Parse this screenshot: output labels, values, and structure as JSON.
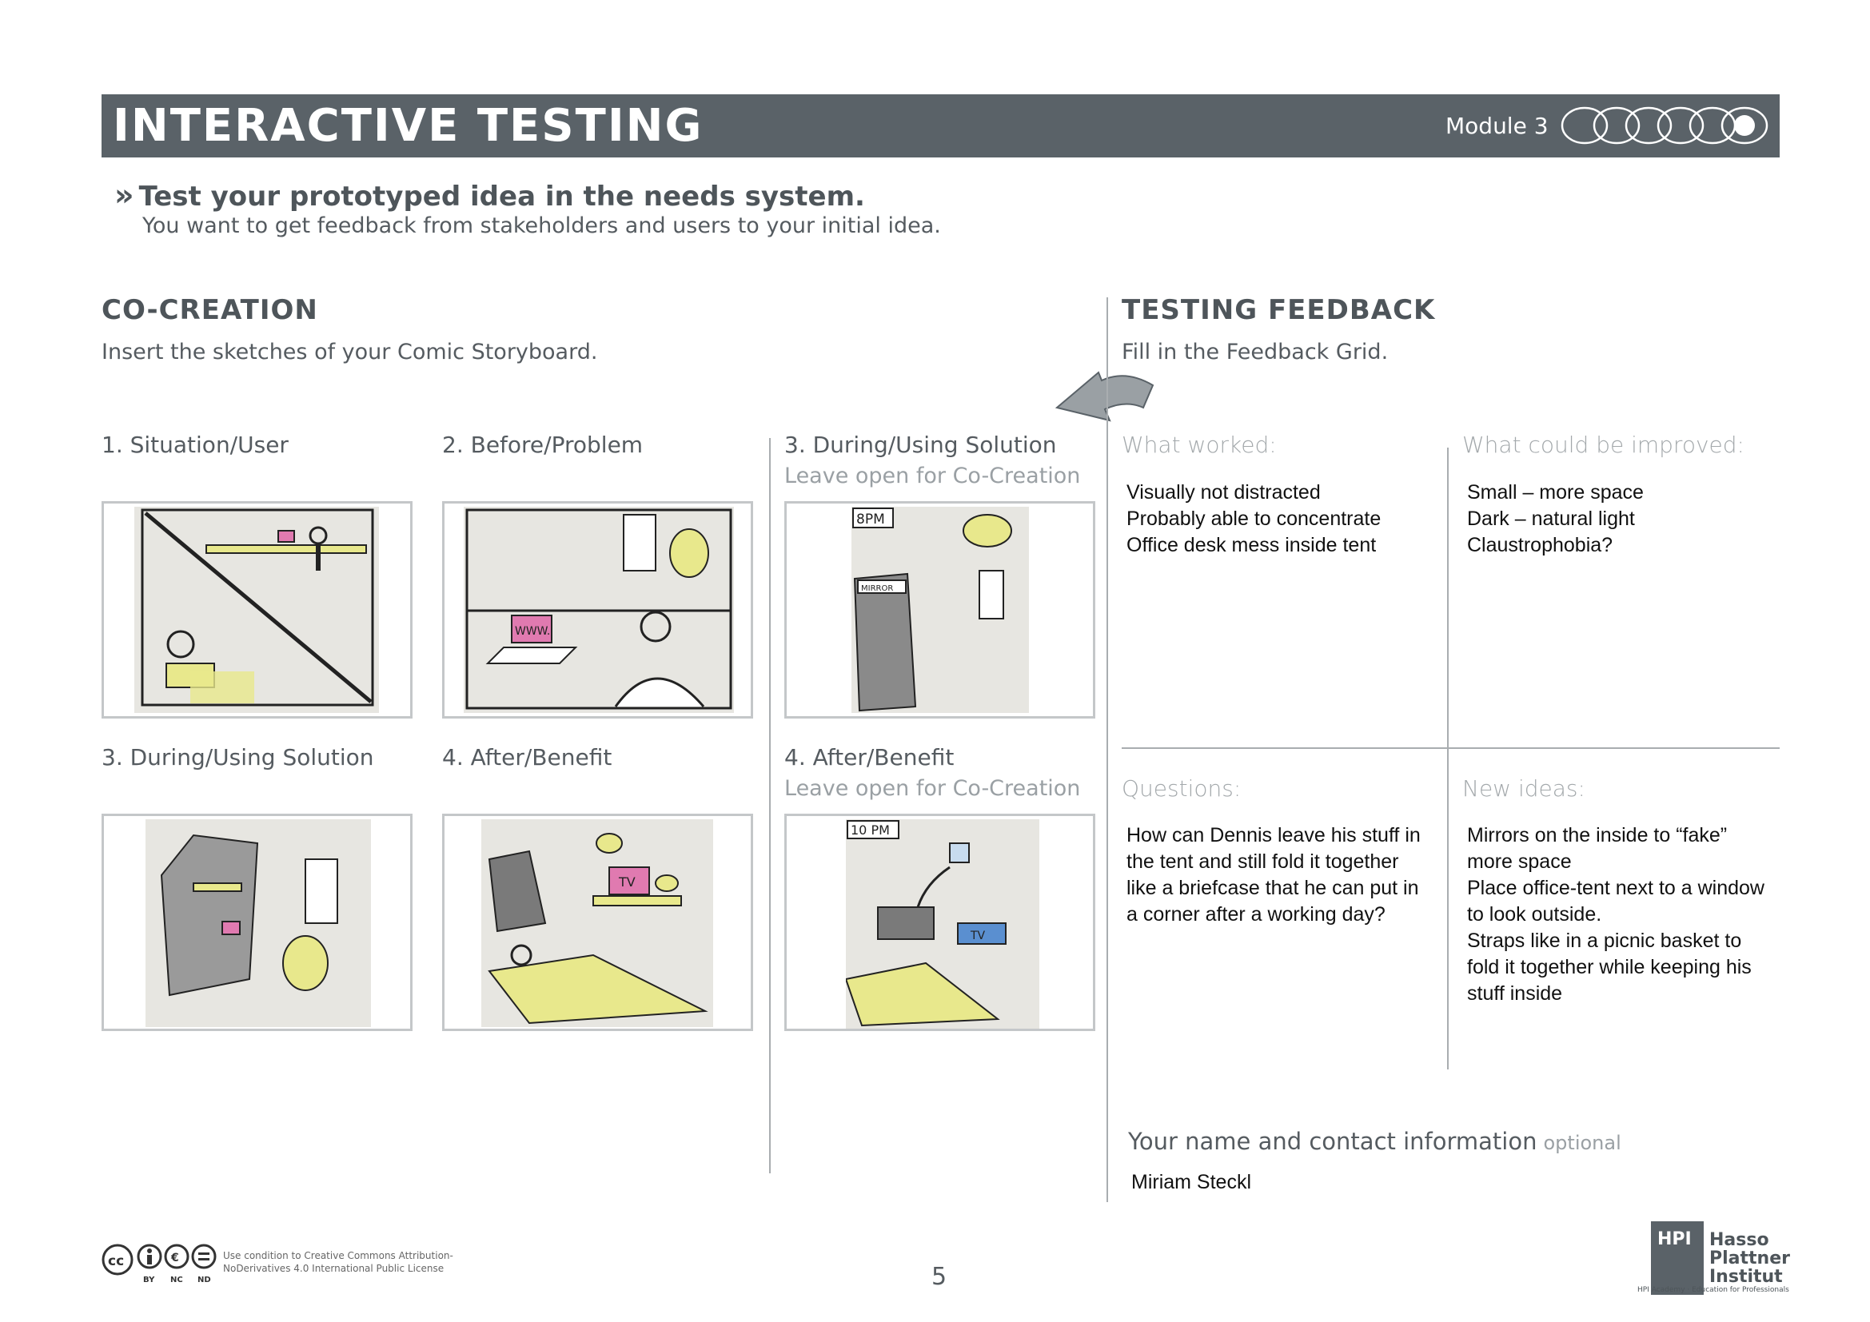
{
  "header": {
    "title": "INTERACTIVE TESTING",
    "module": "Module 3",
    "progress_total": 6,
    "progress_current": 6
  },
  "intro": {
    "title": "Test your prototyped idea in the needs system.",
    "subtitle": "You want to get feedback from stakeholders and users to your initial idea."
  },
  "cocreation": {
    "title": "CO-CREATION",
    "description": "Insert the sketches of your Comic Storyboard.",
    "panels": [
      {
        "label": "1. Situation/User",
        "note": ""
      },
      {
        "label": "2. Before/Problem",
        "note": ""
      },
      {
        "label": "3. During/Using Solution",
        "note": "Leave open for Co-Creation",
        "sketch_text": [
          "8PM",
          "MIRROR"
        ]
      },
      {
        "label": "3. During/Using Solution",
        "note": ""
      },
      {
        "label": "4. After/Benefit",
        "note": "",
        "sketch_text": [
          "TV"
        ]
      },
      {
        "label": "4. After/Benefit",
        "note": "Leave open for Co-Creation",
        "sketch_text": [
          "10 PM",
          "TV"
        ]
      }
    ],
    "sketch_www": "WWW."
  },
  "feedback": {
    "title": "TESTING FEEDBACK",
    "description": "Fill in the Feedback Grid.",
    "worked": {
      "label": "What worked:",
      "lines": [
        "Visually not distracted",
        "Probably able to concentrate",
        "Office desk mess inside tent"
      ]
    },
    "improved": {
      "label": "What could be improved:",
      "lines": [
        "Small – more space",
        "Dark – natural light",
        "Claustrophobia?"
      ]
    },
    "questions": {
      "label": "Questions:",
      "lines": [
        "How can Dennis leave his stuff in",
        "the tent and still fold it together",
        "like a briefcase that he can put in",
        "a corner after a working day?"
      ]
    },
    "ideas": {
      "label": "New ideas:",
      "lines": [
        "Mirrors on the inside to “fake”",
        "more space",
        "Place office-tent next to a window",
        "to look outside.",
        "Straps like in a picnic basket to",
        "fold it together while keeping his",
        "stuff inside"
      ]
    }
  },
  "contact": {
    "label": "Your name and contact information",
    "optional": "optional",
    "value": "Miriam Steckl"
  },
  "footer": {
    "license_line1": "Use condition to Creative Commons Attribution-",
    "license_line2": "NoDerivatives 4.0 International Public License",
    "cc_labels": [
      "BY",
      "NC",
      "ND"
    ],
    "page": "5",
    "hpi_abbr": "HPI",
    "hpi_name": [
      "Hasso",
      "Plattner",
      "Institut"
    ],
    "hpi_tagline": "HPI Academy · Education for Professionals"
  },
  "colors": {
    "band": "#5a6268",
    "text": "#555b60",
    "highlight": "#e8e88c",
    "pink": "#e07ab0",
    "blue": "#5a8fd0"
  }
}
